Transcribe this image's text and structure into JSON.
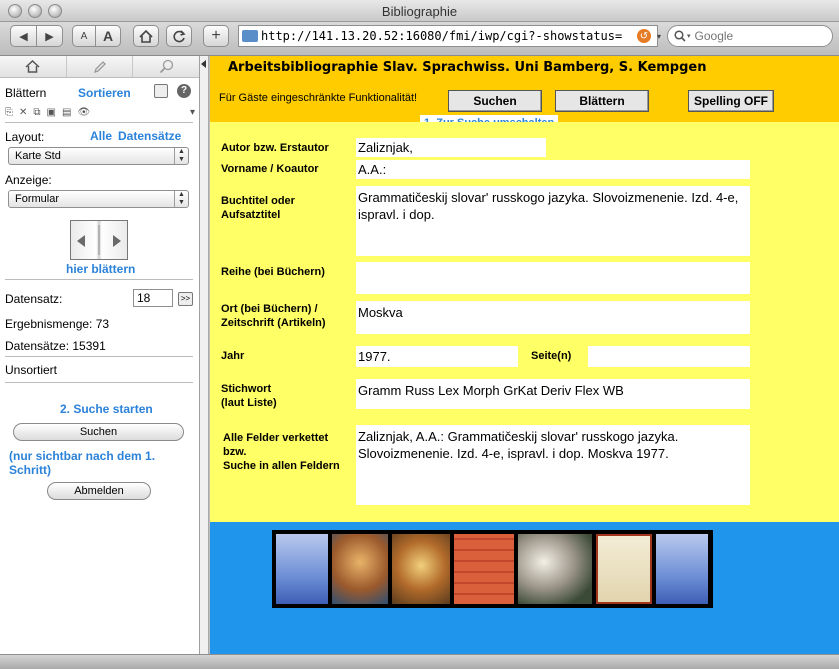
{
  "window": {
    "title": "Bibliographie"
  },
  "browser": {
    "back_label": "◀",
    "forward_label": "▶",
    "text_small": "A",
    "text_large": "A",
    "add_label": "+",
    "url": "http://141.13.20.52:16080/fmi/iwp/cgi?-showstatus=",
    "search_placeholder": "Google"
  },
  "sidebar": {
    "mode_label": "Blättern",
    "sort_label": "Sortieren",
    "layout_label": "Layout:",
    "all_label": "Alle",
    "records_link": "Datensätze",
    "layout_value": "Karte Std",
    "view_label": "Anzeige:",
    "view_value": "Formular",
    "flip_label": "hier blättern",
    "record_label": "Datensatz:",
    "record_value": "18",
    "go_label": ">>",
    "result_label": "Ergebnismenge: 73",
    "total_label": "Datensätze: 15391",
    "sort_state": "Unsortiert",
    "step2_label": "2. Suche starten",
    "search_button": "Suchen",
    "search_hint": "(nur sichtbar nach dem 1. Schritt)",
    "logout_button": "Abmelden"
  },
  "header": {
    "title": "Arbeitsbibliographie Slav. Sprachwiss. Uni Bamberg, S. Kempgen",
    "guest_note": "Für Gäste eingeschränkte Funktionalität!",
    "search_button": "Suchen",
    "browse_button": "Blättern",
    "spelling_button": "Spelling OFF",
    "switch_link": "1. Zur Suche umschalten"
  },
  "record": {
    "author_label": "Autor bzw. Erstautor",
    "author": "Zaliznjak,",
    "firstname_label": "Vorname / Koautor",
    "firstname": "A.A.:",
    "title_label_1": "Buchtitel oder",
    "title_label_2": "Aufsatztitel",
    "title": "Grammatičeskij slovar' russkogo jazyka. Slovoizmenenie. Izd. 4-e, ispravl. i dop.",
    "series_label": "Reihe (bei Büchern)",
    "series": "",
    "place_label_1": "Ort (bei Büchern) /",
    "place_label_2": "Zeitschrift (Artikeln)",
    "place": "Moskva",
    "year_label": "Jahr",
    "year": "1977.",
    "pages_label": "Seite(n)",
    "pages": "",
    "keyword_label_1": "Stichwort",
    "keyword_label_2": "(laut Liste)",
    "keywords": "Gramm Russ Lex Morph GrKat Deriv Flex WB",
    "all_label_1": "Alle Felder verkettet",
    "all_label_2": "bzw.",
    "all_label_3": "Suche in allen Feldern",
    "all_fields": "Zaliznjak, A.A.: Grammatičeskij slovar' russkogo jazyka. Slovoizmenenie. Izd. 4-e, ispravl. i dop. Moskva 1977."
  },
  "colors": {
    "header_bg": "#ffcc00",
    "main_bg": "#ffff66",
    "footer_bg": "#1f96ec",
    "link_blue": "#2b82d9"
  },
  "icons": [
    "home-icon",
    "pencil-icon",
    "magnifier-icon",
    "help-icon",
    "eye-icon",
    "book-flip-icon",
    "reload-icon",
    "plus-icon"
  ]
}
